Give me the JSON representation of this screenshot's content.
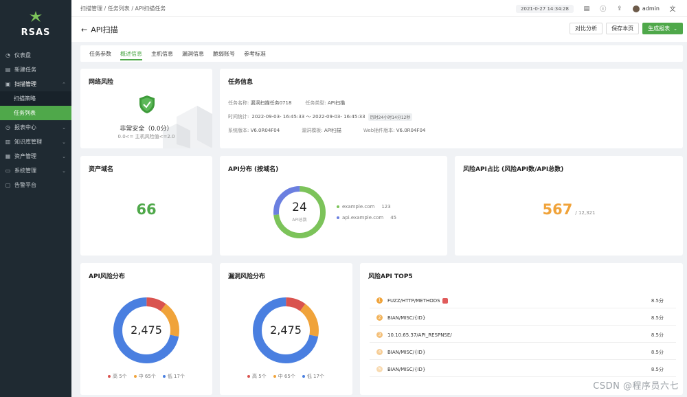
{
  "sidebar": {
    "brand": "RSAS",
    "items": [
      {
        "label": "仪表盘"
      },
      {
        "label": "新建任务"
      },
      {
        "label": "扫描管理"
      },
      {
        "label": "扫描策略"
      },
      {
        "label": "任务列表"
      },
      {
        "label": "报表中心"
      },
      {
        "label": "知识库管理"
      },
      {
        "label": "资产管理"
      },
      {
        "label": "系统管理"
      },
      {
        "label": "告警平台"
      }
    ]
  },
  "topbar": {
    "breadcrumb": "扫描管理 / 任务列表 / API扫描任务",
    "datetime": "2021-0-27 14:34:28",
    "user": "admin"
  },
  "page": {
    "title": "API扫描",
    "buttons": {
      "compare": "对比分析",
      "save": "保存本页",
      "generate": "生成报表"
    }
  },
  "tabs": [
    "任务参数",
    "概述信息",
    "主机信息",
    "漏洞信息",
    "脆弱账号",
    "参考标准"
  ],
  "network_risk": {
    "title": "网络风险",
    "level": "非常安全（0.0分）",
    "range": "0.0<= 主机风险值<=2.0"
  },
  "task_info": {
    "title": "任务信息",
    "name_label": "任务名称:",
    "name": "漏洞扫描任务0718",
    "type_label": "任务类型:",
    "type": "API扫描",
    "time_label": "时间统计:",
    "time": "2022-09-03- 16:45:33 ～ 2022-09-03- 16:45:33",
    "duration": "历时24小时14分12秒",
    "version_label": "系统版本:",
    "version": "V6.0R04F04",
    "template_label": "漏洞模板:",
    "template": "API扫描",
    "plugin_label": "Web插件版本:",
    "plugin": "V6.0R04F04"
  },
  "asset_domain": {
    "title": "资产域名",
    "value": "66"
  },
  "api_distribution": {
    "title": "API分布 (按域名)",
    "total": "24",
    "total_label": "API总数",
    "entries": [
      {
        "name": "example.com",
        "value": "123",
        "color": "#7cc35a"
      },
      {
        "name": "api.example.com",
        "value": "45",
        "color": "#6b7fe0"
      }
    ]
  },
  "risk_api_ratio": {
    "title": "风险API占比 (风险API数/API总数)",
    "value": "567",
    "total": "/ 12,321"
  },
  "api_risk_dist": {
    "title": "API风险分布",
    "total": "2,475",
    "legend": [
      {
        "label": "高 5个",
        "color": "#d9534f"
      },
      {
        "label": "中 65个",
        "color": "#f0a33a"
      },
      {
        "label": "低 17个",
        "color": "#4a7fe0"
      }
    ]
  },
  "vuln_risk_dist": {
    "title": "漏洞风险分布",
    "total": "2,475",
    "legend": [
      {
        "label": "高 5个",
        "color": "#d9534f"
      },
      {
        "label": "中 65个",
        "color": "#f0a33a"
      },
      {
        "label": "低 17个",
        "color": "#4a7fe0"
      }
    ]
  },
  "top5": {
    "title": "风险API TOP5",
    "rows": [
      {
        "rank": "1",
        "name": "FUZZ/HTTP/METHODS",
        "score": "8.5分",
        "color": "#f0a33a"
      },
      {
        "rank": "2",
        "name": "BIAN/MISC/{ID}",
        "score": "8.5分",
        "color": "#f2b35a"
      },
      {
        "rank": "3",
        "name": "10.10.65.37/API_RESPNSE/",
        "score": "8.5分",
        "color": "#f4c07a"
      },
      {
        "rank": "4",
        "name": "BIAN/MISC/{ID}",
        "score": "8.5分",
        "color": "#f6cd96"
      },
      {
        "rank": "5",
        "name": "BIAN/MISC/{ID}",
        "score": "8.5分",
        "color": "#f8dab0"
      }
    ]
  },
  "watermark": "CSDN @程序员六七"
}
